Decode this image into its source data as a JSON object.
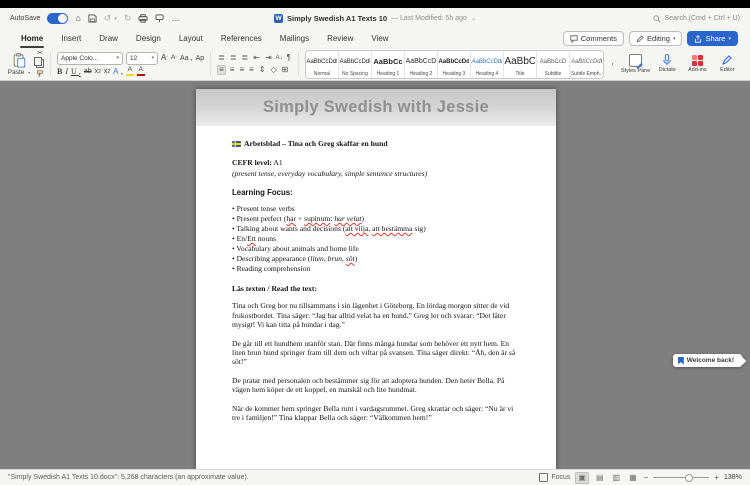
{
  "colors": {
    "accent_blue": "#2a66c9",
    "dictate_blue": "#3a7bd5",
    "addins_red": "#d13438",
    "editor_blue": "#2e6fce",
    "squiggle_red": "#e23b2e",
    "banner_gray": "#d6d6d6"
  },
  "icons": {
    "home": "⌂",
    "undo": "↺",
    "redo": "↻",
    "more": "…",
    "chevron_down": "⌄",
    "dropdown": "▾",
    "scissors": "✂",
    "paragraph_mark": "¶",
    "sort": "A↓",
    "indent_left": "⇤",
    "indent_right": "⇥",
    "list": "≣",
    "align": "≡",
    "borders": "⊞",
    "line_spacing": "⇕",
    "bucket": "◇",
    "expand": "›",
    "minus": "−",
    "plus": "+",
    "web_view": "▤",
    "outline_view": "▥",
    "draft_view": "▦",
    "print_view": "▣"
  },
  "titlebar": {
    "autosave_label": "AutoSave",
    "doc_title": "Simply Swedish A1 Texts 10",
    "modified_suffix": "— Last Modified: 5h ago",
    "search_placeholder": "Search (Cmd + Ctrl + U)",
    "word_glyph": "W"
  },
  "ribbon": {
    "tabs": [
      "Home",
      "Insert",
      "Draw",
      "Design",
      "Layout",
      "References",
      "Mailings",
      "Review",
      "View"
    ],
    "active_tab": "Home",
    "comments_label": "Comments",
    "editing_label": "Editing",
    "share_label": "Share",
    "paste_label": "Paste",
    "font_name": "Apple Colo...",
    "font_size": "12",
    "grow_font": "A",
    "shrink_font": "A",
    "change_case": "Aa",
    "clear_format": "Ap",
    "bold": "B",
    "italic": "I",
    "underline": "U",
    "strikethrough": "ab",
    "subscript": "x",
    "superscript": "x",
    "text_effects": "A",
    "highlight": "A",
    "font_color": "A",
    "styles": [
      {
        "sample": "AaBbCcDdE",
        "name": "Normal"
      },
      {
        "sample": "AaBbCcDdE",
        "name": "No Spacing"
      },
      {
        "sample": "AaBbCc",
        "name": "Heading 1"
      },
      {
        "sample": "AaBbCcD",
        "name": "Heading 2"
      },
      {
        "sample": "AaBbCcDdE",
        "name": "Heading 3"
      },
      {
        "sample": "AaBbCcDdE",
        "name": "Heading 4"
      },
      {
        "sample": "AaBbC",
        "name": "Title"
      },
      {
        "sample": "AaBbCcD",
        "name": "Subtitle"
      },
      {
        "sample": "AaBbCcDdE",
        "name": "Subtle Emph..."
      }
    ],
    "styles_pane_label": "Styles Pane",
    "dictate_label": "Dictate",
    "addins_label": "Add-ins",
    "editor_label": "Editor"
  },
  "document": {
    "banner_title": "Simply Swedish with Jessie",
    "worksheet_title": "Arbetsblad – Tina och Greg skaffar en hund",
    "cefr_label": "CEFR level:",
    "cefr_value": " A1",
    "cefr_note": "(present tense, everyday vocabulary, simple sentence structures)",
    "learning_focus_heading": "Learning Focus:",
    "learning_bullets": [
      [
        {
          "t": "Present tense verbs"
        }
      ],
      [
        {
          "t": "Present perfect ("
        },
        {
          "t": "har",
          "sq": true
        },
        {
          "t": " + "
        },
        {
          "t": "supinum",
          "sq": true
        },
        {
          "t": ": "
        },
        {
          "t": "har velat",
          "i": true,
          "sq": true
        },
        {
          "t": ")"
        }
      ],
      [
        {
          "t": "Talking about wants and decisions ("
        },
        {
          "t": "att vilja",
          "sq": true
        },
        {
          "t": ", "
        },
        {
          "t": "att bestämma",
          "sq": true
        },
        {
          "t": " sig)"
        }
      ],
      [
        {
          "t": "En/"
        },
        {
          "t": "Ett",
          "sq": true
        },
        {
          "t": " nouns"
        }
      ],
      [
        {
          "t": "Vocabulary about animals and home life"
        }
      ],
      [
        {
          "t": "Describing appearance ("
        },
        {
          "t": "liten, brun, ",
          "i": true
        },
        {
          "t": "söt",
          "i": true,
          "sq": true
        },
        {
          "t": ")"
        }
      ],
      [
        {
          "t": "Reading comprehension"
        }
      ]
    ],
    "read_heading": "Läs texten / Read the text:",
    "paragraphs": [
      "Tina och Greg bor nu tillsammans i sin lägenhet i Göteborg. En lördag morgon sitter de vid frukostbordet. Tina säger: “Jag har alltid velat ha en hund.” Greg ler och svarar: “Det låter mysigt! Vi kan titta på hundar i dag.”",
      "De går till ett hundhem utanför stan. Där finns många hundar som behöver ett nytt hem. En liten brun hund springer fram till dem och viftar på svansen. Tina säger direkt: “Åh, den är så söt!”",
      "De pratar med personalen och bestämmer sig för att adoptera hunden. Den heter Bella. På vägen hem köper de ett koppel, en matskål och lite hundmat.",
      "När de kommer hem springer Bella runt i vardagsrummet. Greg skrattar och säger: “Nu är vi tre i familjen!” Tina klappar Bella och säger: “Välkommen hem!”"
    ]
  },
  "welcome_tooltip": {
    "label": "Welcome back!"
  },
  "statusbar": {
    "left_text": "\"Simply Swedish A1 Texts 10.docx\": 5,268 characters (an approximate value).",
    "focus_label": "Focus",
    "zoom_percent": "138%"
  }
}
